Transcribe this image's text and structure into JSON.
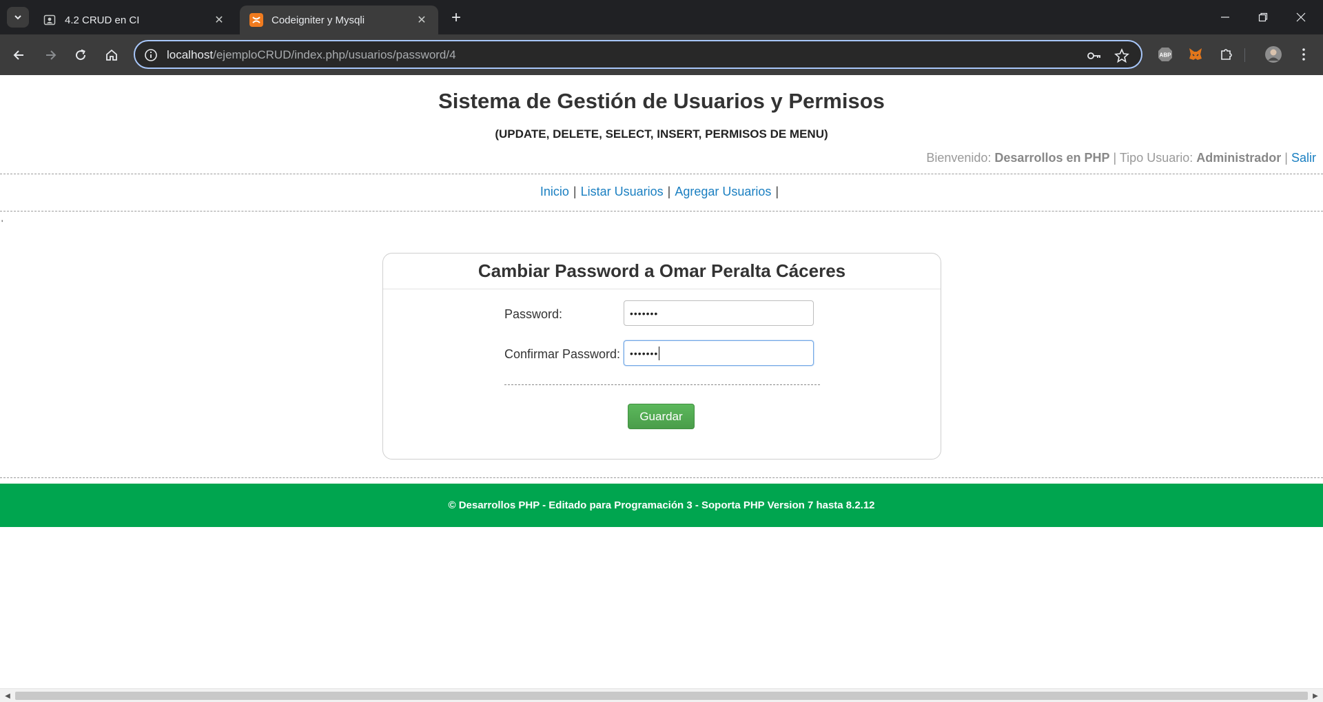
{
  "browser": {
    "tabs": [
      {
        "title": "4.2 CRUD en CI",
        "favicon": "contact-card-icon",
        "active": false
      },
      {
        "title": "Codeigniter y Mysqli",
        "favicon": "xampp-icon",
        "active": true
      }
    ],
    "url_host": "localhost",
    "url_path": "/ejemploCRUD/index.php/usuarios/password/4",
    "extensions": [
      "adblock-plus-icon",
      "metamask-fox-icon",
      "puzzle-extensions-icon",
      "profile-avatar"
    ]
  },
  "header": {
    "title": "Sistema de Gestión de Usuarios y Permisos",
    "subtitle": "(UPDATE, DELETE, SELECT, INSERT, PERMISOS DE MENU)",
    "welcome_prefix": "Bienvenido:",
    "user_name": "Desarrollos en PHP",
    "separator": "|",
    "type_prefix": "Tipo Usuario:",
    "user_type": "Administrador",
    "logout": "Salir"
  },
  "menu": {
    "items": [
      "Inicio",
      "Listar Usuarios",
      "Agregar Usuarios"
    ],
    "separator": "|"
  },
  "stray_mark": "'",
  "form": {
    "title": "Cambiar Password a Omar Peralta Cáceres",
    "password_label": "Password:",
    "password_value": "•••••••",
    "confirm_label": "Confirmar Password:",
    "confirm_value": "•••••••",
    "save_label": "Guardar"
  },
  "footer": {
    "text": "© Desarrollos PHP - Editado para Programación 3 - Soporta PHP Version 7 hasta 8.2.12"
  },
  "colors": {
    "footer_bg": "#00a54f",
    "link": "#1a7fc1",
    "button": "#5cb85c"
  }
}
